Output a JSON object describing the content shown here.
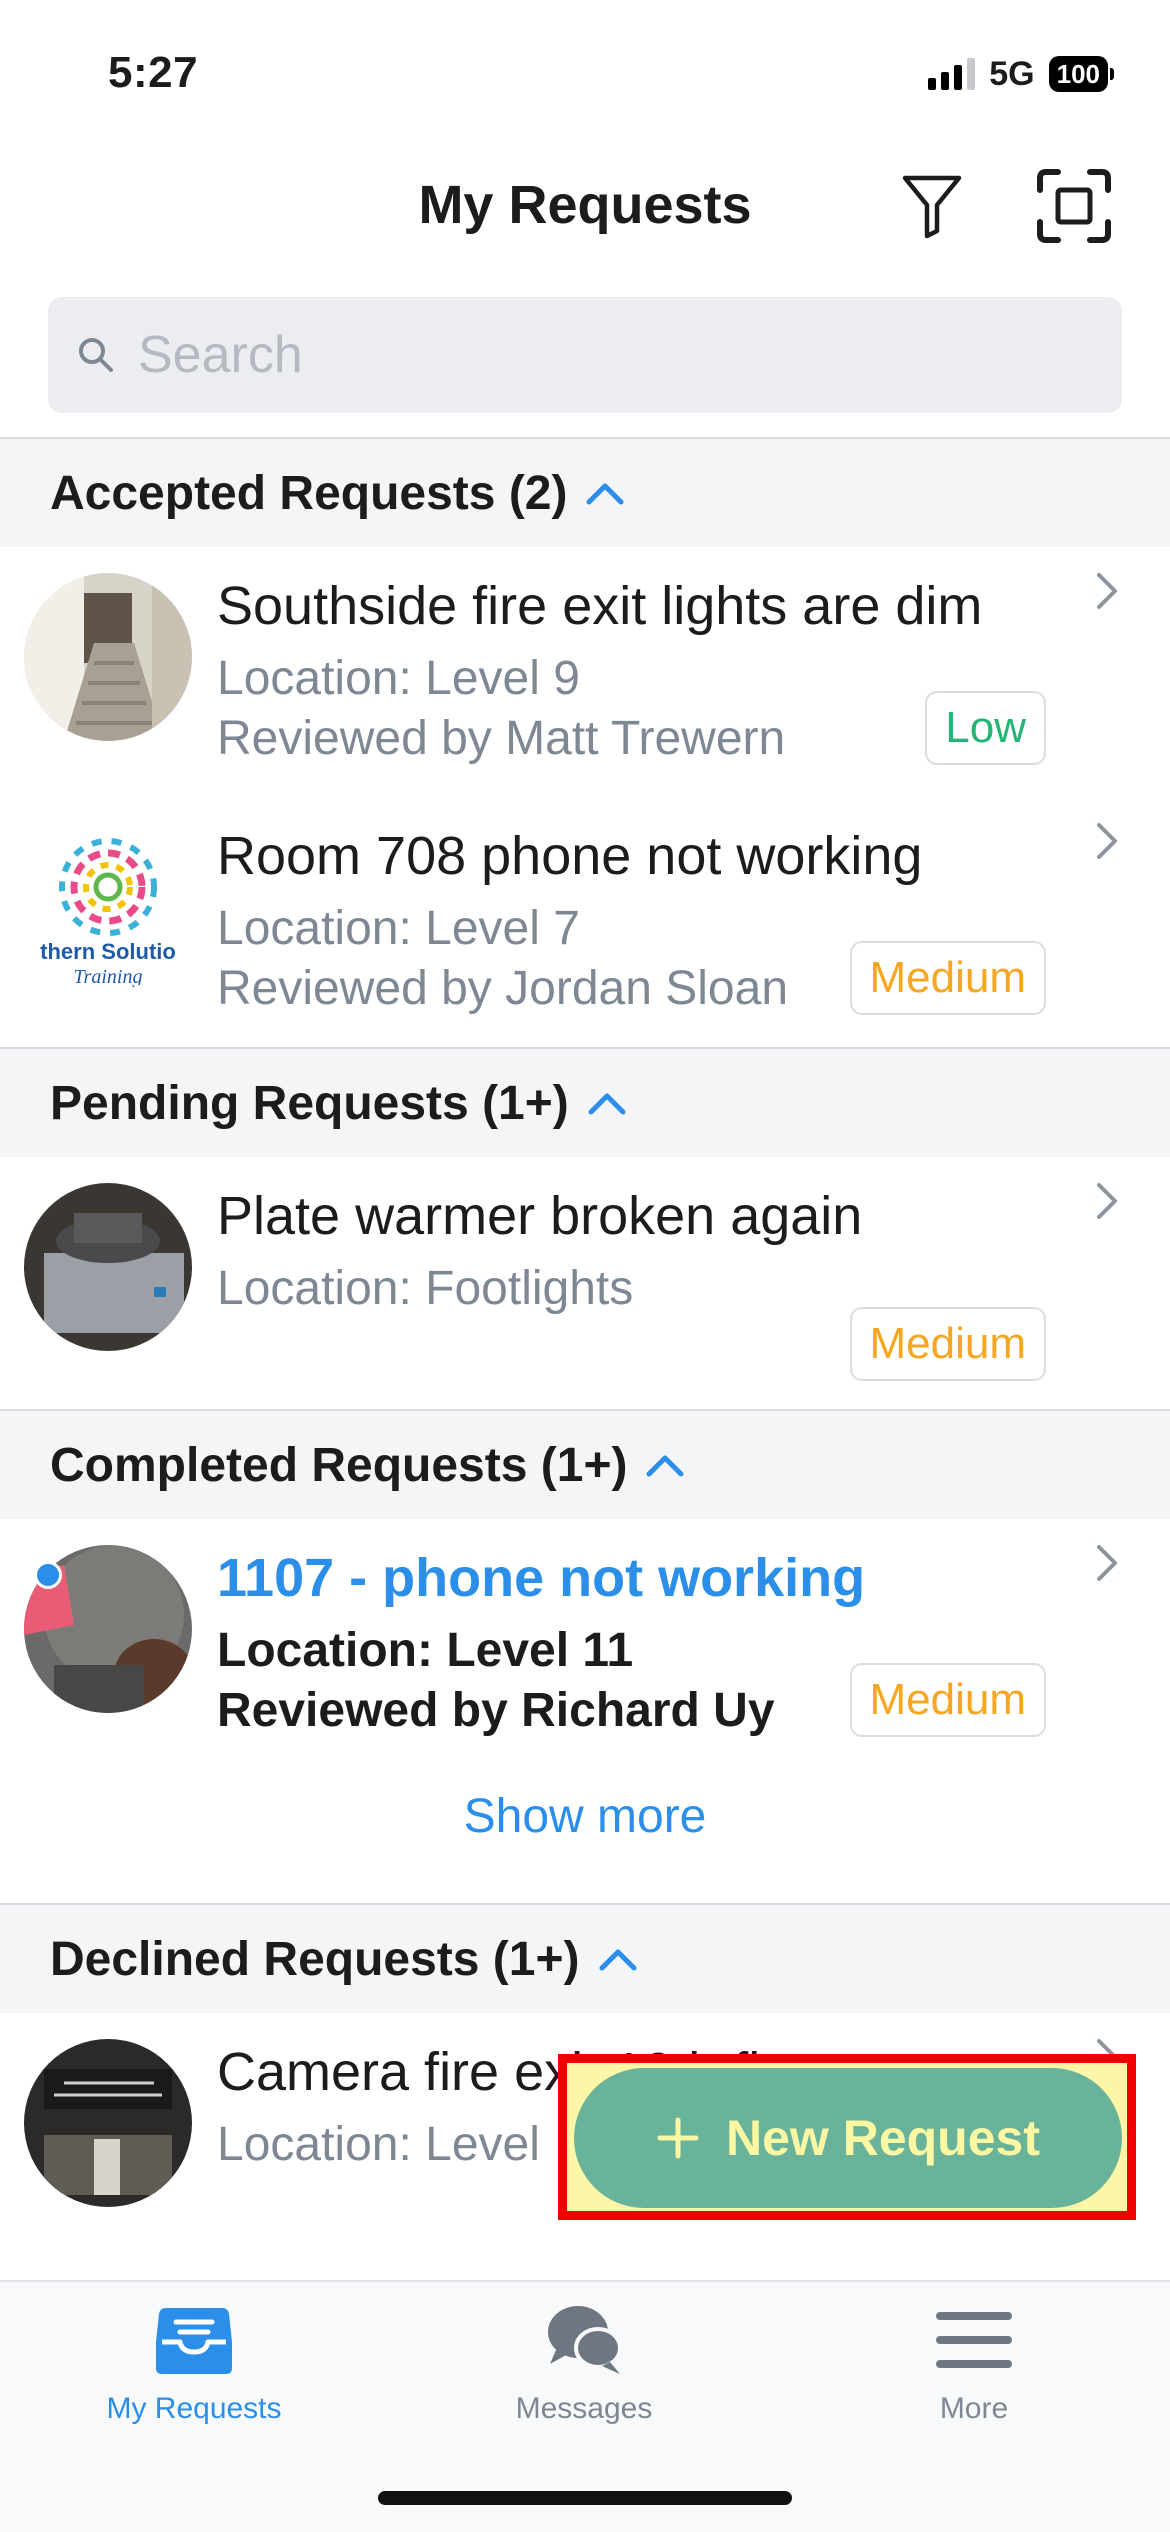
{
  "status_bar": {
    "time": "5:27",
    "network": "5G",
    "battery": "100"
  },
  "header": {
    "title": "My Requests"
  },
  "search": {
    "placeholder": "Search",
    "value": ""
  },
  "sections": [
    {
      "title": "Accepted Requests (2)",
      "items": [
        {
          "title": "Southside fire exit lights are dim",
          "location": "Location: Level 9",
          "reviewer": "Reviewed by Matt Trewern",
          "priority": "Low"
        },
        {
          "title": "Room 708 phone not working",
          "location": "Location: Level 7",
          "reviewer": "Reviewed by Jordan Sloan",
          "priority": "Medium",
          "avatar_text_1": "thern Solutio",
          "avatar_text_2": "Training"
        }
      ]
    },
    {
      "title": "Pending Requests (1+)",
      "items": [
        {
          "title": "Plate warmer broken again",
          "location": "Location: Footlights",
          "priority": "Medium"
        }
      ]
    },
    {
      "title": "Completed Requests (1+)",
      "items": [
        {
          "title": "1107 - phone not working",
          "location": "Location: Level 11",
          "reviewer": "Reviewed by Richard Uy",
          "priority": "Medium"
        }
      ],
      "show_more": "Show more"
    },
    {
      "title": "Declined Requests (1+)",
      "items": [
        {
          "title": "Camera fire exit 10th floor",
          "location": "Location: Level"
        }
      ]
    }
  ],
  "fab": {
    "label": "New Request"
  },
  "tabs": [
    {
      "label": "My Requests",
      "active": true
    },
    {
      "label": "Messages",
      "active": false
    },
    {
      "label": "More",
      "active": false
    }
  ],
  "colors": {
    "accent": "#2b8ee8",
    "low": "#22b574",
    "medium": "#f5a623",
    "fab": "#69b39b",
    "fab_text": "#fcf7a3",
    "highlight_border": "#f10000"
  }
}
